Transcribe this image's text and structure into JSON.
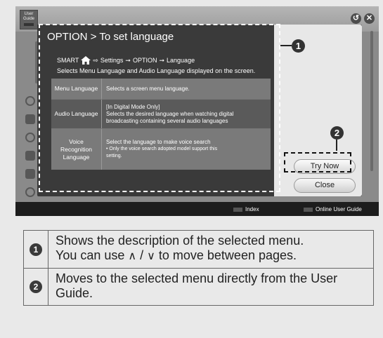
{
  "screen": {
    "logo_line1": "User",
    "logo_line2": "Guide",
    "back_glyph": "↺",
    "close_glyph": "✕",
    "bottom_bar": {
      "index_label": "Index",
      "online_label": "Online User Guide"
    }
  },
  "dialog": {
    "title": "OPTION > To set language",
    "breadcrumb": {
      "smart": "SMART",
      "home_icon": "home-icon",
      "arrow1": "⇨",
      "settings": "Settings",
      "arrow2": "➞",
      "option": "OPTION",
      "arrow3": "➞",
      "language": "Language"
    },
    "description": "Selects Menu Language and Audio Language displayed on the screen.",
    "options": [
      {
        "name": "Menu Language",
        "lines": [
          "Selects a screen menu language."
        ]
      },
      {
        "name": "Audio Language",
        "lines": [
          "[In Digital Mode Only]",
          "Selects the desired language when watching digital",
          "broadcasting containing several audio languages"
        ]
      },
      {
        "name": "Voice Recognition Language",
        "lines": [
          "Select the language to make voice search",
          "• Only the voice search adopted model support this",
          "setting."
        ]
      }
    ],
    "try_now_label": "Try Now",
    "close_label": "Close"
  },
  "callouts": {
    "one": "1",
    "two": "2"
  },
  "legend": [
    {
      "num": "1",
      "text_a": "Shows the description of the selected menu.",
      "text_b_pre": "You can use ",
      "up_glyph": "∧",
      "sep": " / ",
      "down_glyph": "∨",
      "text_b_post": " to move between pages."
    },
    {
      "num": "2",
      "text": "Moves to the selected menu directly from the User Guide."
    }
  ]
}
